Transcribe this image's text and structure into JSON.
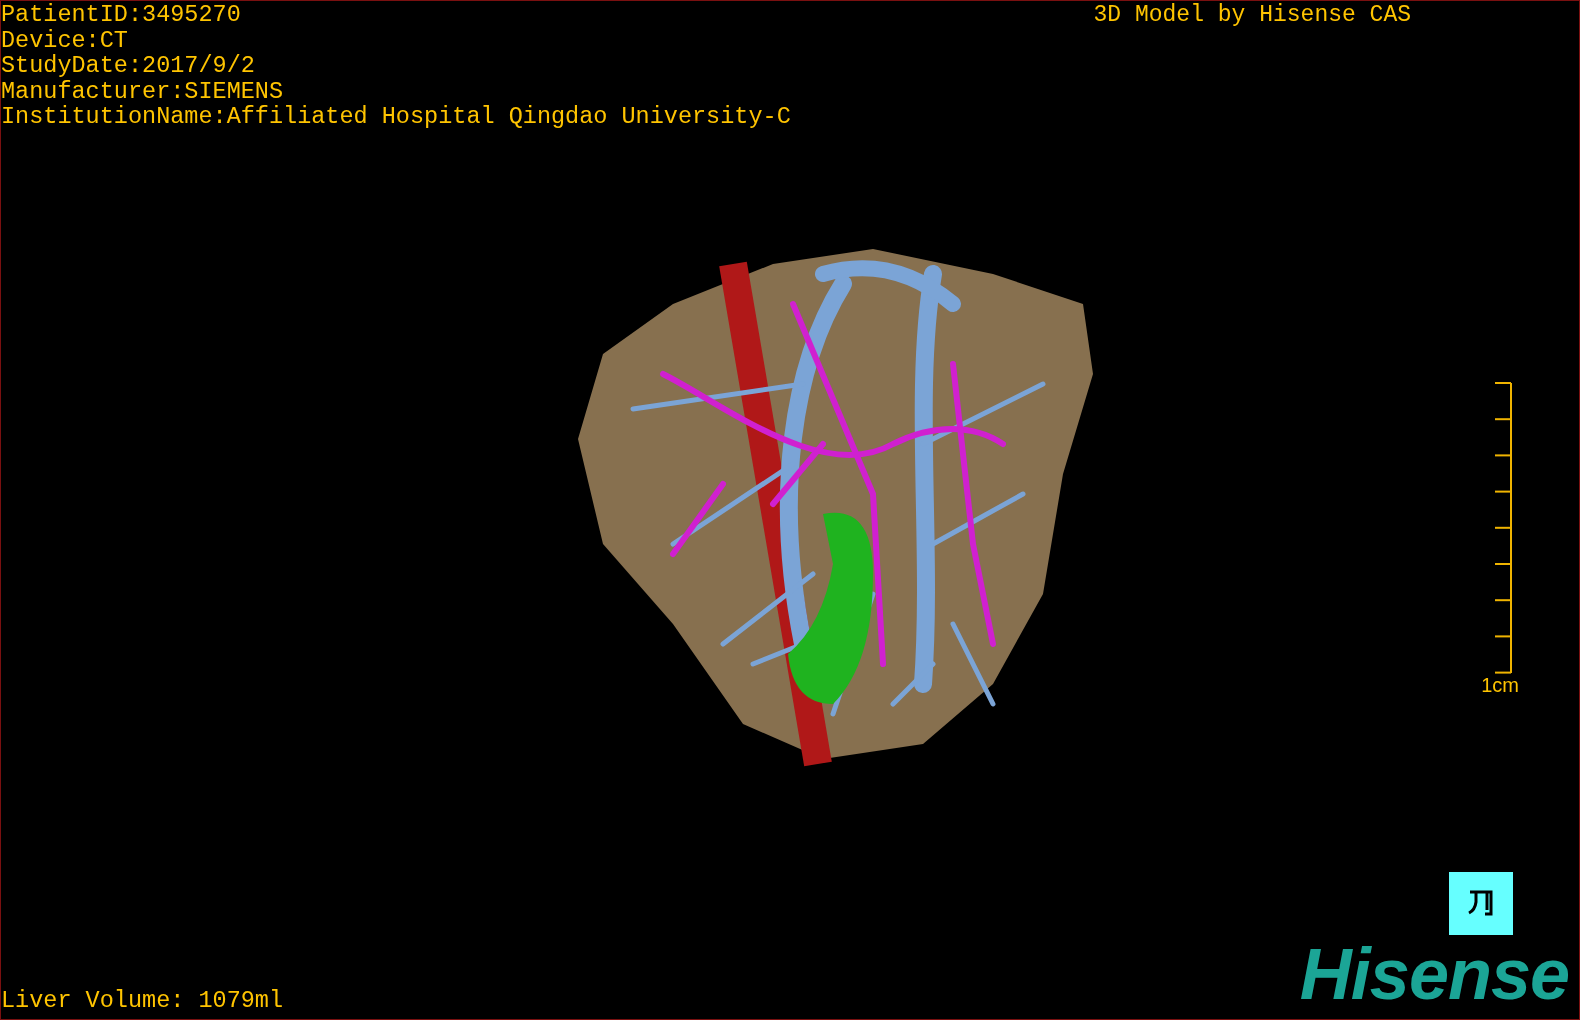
{
  "header": {
    "info_lines": [
      "PatientID:3495270",
      "Device:CT",
      "StudyDate:2017/9/2",
      "Manufacturer:SIEMENS",
      "InstitutionName:Affiliated Hospital Qingdao University-C"
    ],
    "title": "3D Model by Hisense CAS"
  },
  "scale_bar": {
    "label": "1cm"
  },
  "liver_volume": "Liver Volume: 1079ml",
  "logo": "Hisense"
}
